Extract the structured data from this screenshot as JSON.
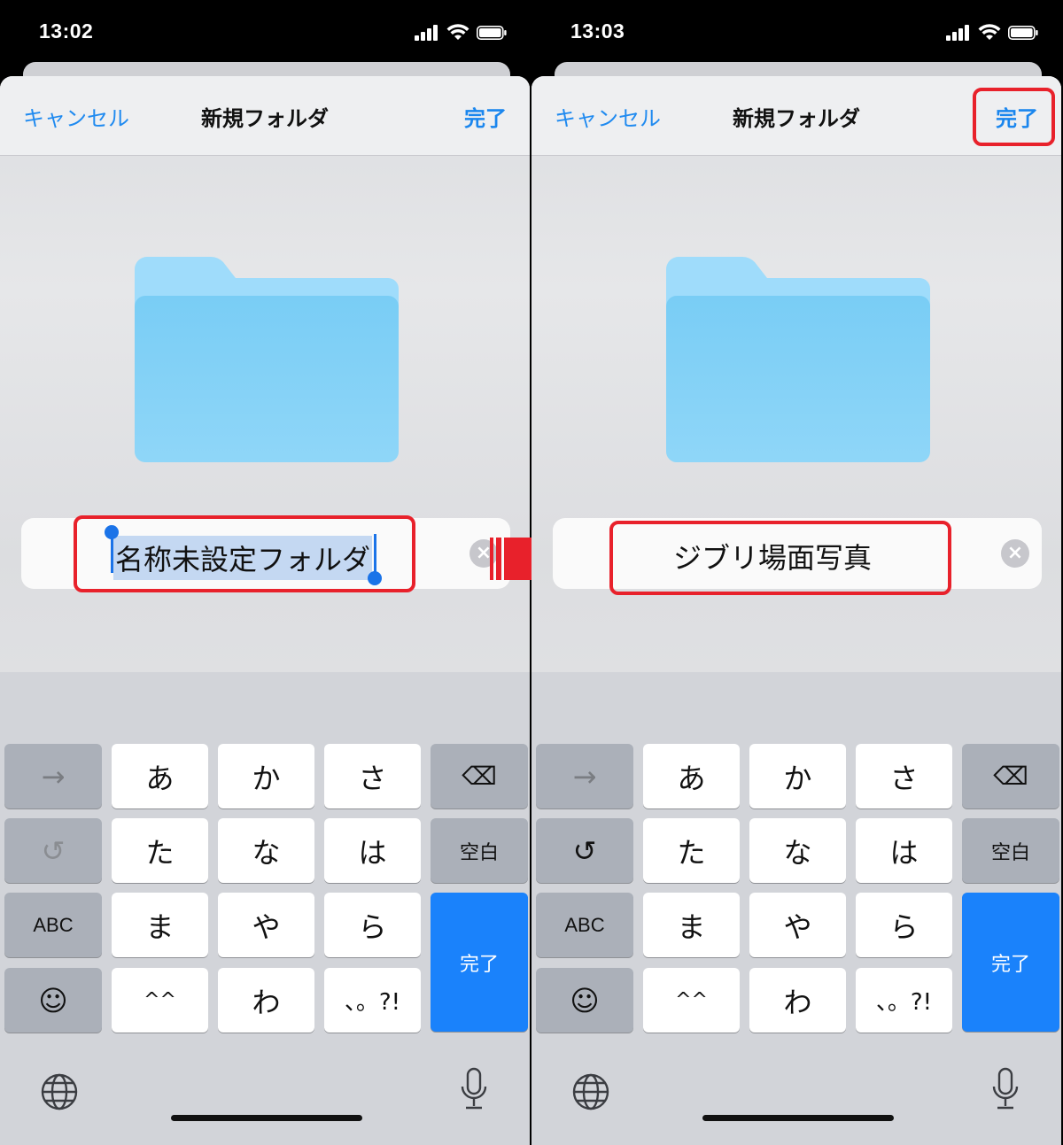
{
  "screens": [
    {
      "status_time": "13:02",
      "nav": {
        "cancel_label": "キャンセル",
        "title": "新規フォルダ",
        "done_label": "完了"
      },
      "folder_icon": "folder-icon",
      "name_field": {
        "value": "名称未設定フォルダ",
        "selected": true
      },
      "keyboard": {
        "rows": [
          [
            "→",
            "あ",
            "か",
            "さ",
            "⌫"
          ],
          [
            "↺",
            "た",
            "な",
            "は",
            "空白"
          ],
          [
            "ABC",
            "ま",
            "や",
            "ら",
            "完了"
          ],
          [
            "☺",
            "^^",
            "わ",
            "、。?!"
          ]
        ]
      }
    },
    {
      "status_time": "13:03",
      "nav": {
        "cancel_label": "キャンセル",
        "title": "新規フォルダ",
        "done_label": "完了"
      },
      "folder_icon": "folder-icon",
      "name_field": {
        "value": "ジブリ場面写真",
        "selected": false
      },
      "keyboard": {
        "rows": [
          [
            "→",
            "あ",
            "か",
            "さ",
            "⌫"
          ],
          [
            "↺",
            "た",
            "な",
            "は",
            "空白"
          ],
          [
            "ABC",
            "ま",
            "や",
            "ら",
            "完了"
          ],
          [
            "☺",
            "^^",
            "わ",
            "、。?!"
          ]
        ]
      }
    }
  ],
  "colors": {
    "accent": "#1a82fb",
    "highlight": "#e8212b",
    "folder": "#7fd0f6"
  }
}
